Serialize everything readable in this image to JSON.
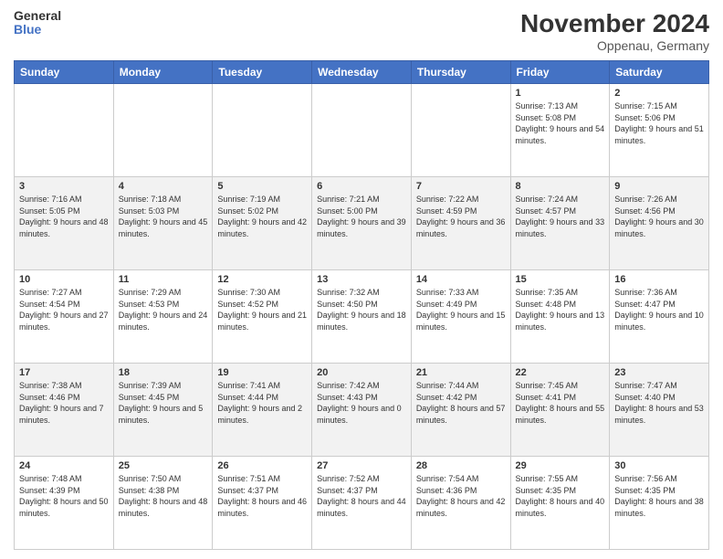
{
  "header": {
    "logo_line1": "General",
    "logo_line2": "Blue",
    "main_title": "November 2024",
    "sub_title": "Oppenau, Germany"
  },
  "weekdays": [
    "Sunday",
    "Monday",
    "Tuesday",
    "Wednesday",
    "Thursday",
    "Friday",
    "Saturday"
  ],
  "weeks": [
    [
      {
        "day": "",
        "info": ""
      },
      {
        "day": "",
        "info": ""
      },
      {
        "day": "",
        "info": ""
      },
      {
        "day": "",
        "info": ""
      },
      {
        "day": "",
        "info": ""
      },
      {
        "day": "1",
        "info": "Sunrise: 7:13 AM\nSunset: 5:08 PM\nDaylight: 9 hours and 54 minutes."
      },
      {
        "day": "2",
        "info": "Sunrise: 7:15 AM\nSunset: 5:06 PM\nDaylight: 9 hours and 51 minutes."
      }
    ],
    [
      {
        "day": "3",
        "info": "Sunrise: 7:16 AM\nSunset: 5:05 PM\nDaylight: 9 hours and 48 minutes."
      },
      {
        "day": "4",
        "info": "Sunrise: 7:18 AM\nSunset: 5:03 PM\nDaylight: 9 hours and 45 minutes."
      },
      {
        "day": "5",
        "info": "Sunrise: 7:19 AM\nSunset: 5:02 PM\nDaylight: 9 hours and 42 minutes."
      },
      {
        "day": "6",
        "info": "Sunrise: 7:21 AM\nSunset: 5:00 PM\nDaylight: 9 hours and 39 minutes."
      },
      {
        "day": "7",
        "info": "Sunrise: 7:22 AM\nSunset: 4:59 PM\nDaylight: 9 hours and 36 minutes."
      },
      {
        "day": "8",
        "info": "Sunrise: 7:24 AM\nSunset: 4:57 PM\nDaylight: 9 hours and 33 minutes."
      },
      {
        "day": "9",
        "info": "Sunrise: 7:26 AM\nSunset: 4:56 PM\nDaylight: 9 hours and 30 minutes."
      }
    ],
    [
      {
        "day": "10",
        "info": "Sunrise: 7:27 AM\nSunset: 4:54 PM\nDaylight: 9 hours and 27 minutes."
      },
      {
        "day": "11",
        "info": "Sunrise: 7:29 AM\nSunset: 4:53 PM\nDaylight: 9 hours and 24 minutes."
      },
      {
        "day": "12",
        "info": "Sunrise: 7:30 AM\nSunset: 4:52 PM\nDaylight: 9 hours and 21 minutes."
      },
      {
        "day": "13",
        "info": "Sunrise: 7:32 AM\nSunset: 4:50 PM\nDaylight: 9 hours and 18 minutes."
      },
      {
        "day": "14",
        "info": "Sunrise: 7:33 AM\nSunset: 4:49 PM\nDaylight: 9 hours and 15 minutes."
      },
      {
        "day": "15",
        "info": "Sunrise: 7:35 AM\nSunset: 4:48 PM\nDaylight: 9 hours and 13 minutes."
      },
      {
        "day": "16",
        "info": "Sunrise: 7:36 AM\nSunset: 4:47 PM\nDaylight: 9 hours and 10 minutes."
      }
    ],
    [
      {
        "day": "17",
        "info": "Sunrise: 7:38 AM\nSunset: 4:46 PM\nDaylight: 9 hours and 7 minutes."
      },
      {
        "day": "18",
        "info": "Sunrise: 7:39 AM\nSunset: 4:45 PM\nDaylight: 9 hours and 5 minutes."
      },
      {
        "day": "19",
        "info": "Sunrise: 7:41 AM\nSunset: 4:44 PM\nDaylight: 9 hours and 2 minutes."
      },
      {
        "day": "20",
        "info": "Sunrise: 7:42 AM\nSunset: 4:43 PM\nDaylight: 9 hours and 0 minutes."
      },
      {
        "day": "21",
        "info": "Sunrise: 7:44 AM\nSunset: 4:42 PM\nDaylight: 8 hours and 57 minutes."
      },
      {
        "day": "22",
        "info": "Sunrise: 7:45 AM\nSunset: 4:41 PM\nDaylight: 8 hours and 55 minutes."
      },
      {
        "day": "23",
        "info": "Sunrise: 7:47 AM\nSunset: 4:40 PM\nDaylight: 8 hours and 53 minutes."
      }
    ],
    [
      {
        "day": "24",
        "info": "Sunrise: 7:48 AM\nSunset: 4:39 PM\nDaylight: 8 hours and 50 minutes."
      },
      {
        "day": "25",
        "info": "Sunrise: 7:50 AM\nSunset: 4:38 PM\nDaylight: 8 hours and 48 minutes."
      },
      {
        "day": "26",
        "info": "Sunrise: 7:51 AM\nSunset: 4:37 PM\nDaylight: 8 hours and 46 minutes."
      },
      {
        "day": "27",
        "info": "Sunrise: 7:52 AM\nSunset: 4:37 PM\nDaylight: 8 hours and 44 minutes."
      },
      {
        "day": "28",
        "info": "Sunrise: 7:54 AM\nSunset: 4:36 PM\nDaylight: 8 hours and 42 minutes."
      },
      {
        "day": "29",
        "info": "Sunrise: 7:55 AM\nSunset: 4:35 PM\nDaylight: 8 hours and 40 minutes."
      },
      {
        "day": "30",
        "info": "Sunrise: 7:56 AM\nSunset: 4:35 PM\nDaylight: 8 hours and 38 minutes."
      }
    ]
  ]
}
